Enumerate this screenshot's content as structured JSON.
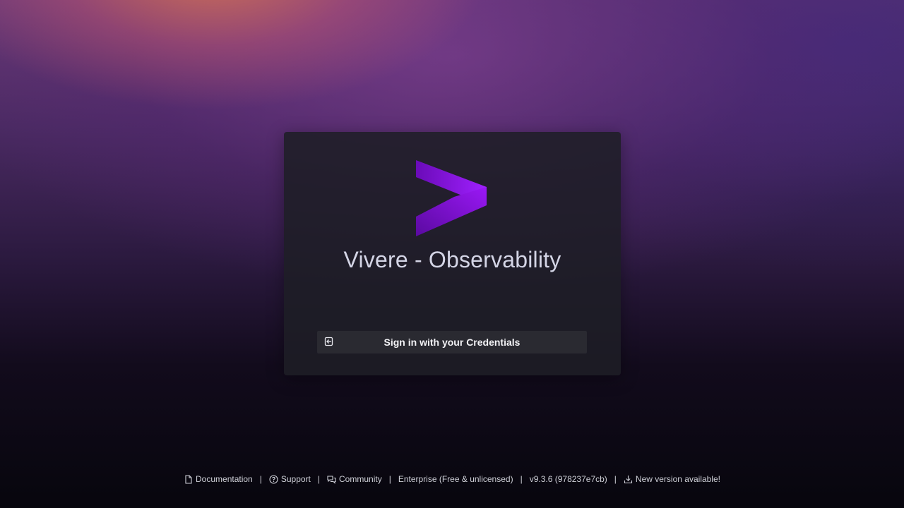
{
  "colors": {
    "accent": "#8c10f0",
    "card_bg": "#1e1e26",
    "button_bg": "#2a2a31"
  },
  "login": {
    "title": "Vivere - Observability",
    "logo_icon": "chevron-right-logo",
    "signin_button": {
      "label": "Sign in with your Credentials",
      "icon": "sign-in-icon"
    }
  },
  "footer": {
    "documentation": {
      "label": "Documentation",
      "icon": "document-icon"
    },
    "support": {
      "label": "Support",
      "icon": "question-circle-icon"
    },
    "community": {
      "label": "Community",
      "icon": "comments-icon"
    },
    "edition": "Enterprise (Free & unlicensed)",
    "version": "v9.3.6 (978237e7cb)",
    "update": {
      "label": "New version available!",
      "icon": "download-icon"
    },
    "separator": "|"
  }
}
